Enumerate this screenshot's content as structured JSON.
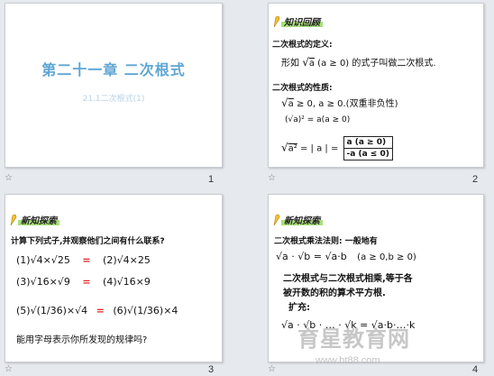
{
  "slides": [
    {
      "title": "第二十一章 二次根式",
      "subtitle": "21.1二次根式(1)",
      "number": "1"
    },
    {
      "badge": "知识回顾",
      "def_heading": "二次根式的定义:",
      "def_text_pre": "形如",
      "def_text_post": "的式子叫做二次根式.",
      "def_expr": "a",
      "def_cond": "(a ≥ 0)",
      "prop_heading": "二次根式的性质:",
      "prop1": "≥ 0, a ≥ 0.(双重非负性)",
      "prop2": "= a(a ≥ 0)",
      "prop3": "= | a | =",
      "case1": "a  (a ≥ 0)",
      "case2": "-a  (a ≤ 0)",
      "number": "2"
    },
    {
      "badge": "新知探索",
      "instruction": "计算下列式子,并观察他们之间有什么联系?",
      "rows": [
        {
          "left": "(1)√4×√25",
          "right": "(2)√4×25"
        },
        {
          "left": "(3)√16×√9",
          "right": "(4)√16×9"
        },
        {
          "left": "(5)√(1/36)×√4",
          "right": "(6)√(1/36)×4"
        }
      ],
      "eq": "=",
      "question": "能用字母表示你所发现的规律吗?",
      "number": "3"
    },
    {
      "badge": "新知探索",
      "rule_heading": "二次根式乘法法则: 一般地有",
      "formula": "√a · √b = √a·b",
      "formula_cond": "(a ≥ 0,b ≥ 0)",
      "explain1": "二次根式与二次根式相乘,等于各",
      "explain2": "被开数的积的算术平方根.",
      "extend": "扩充:",
      "extend_formula": "√a · √b · … · √k = √a·b·…·k",
      "number": "4"
    }
  ],
  "watermark": "育星教育网",
  "watermark_url": "www.ht88.com",
  "colors": {
    "title_blue": "#5ea6d4",
    "highlight_green": "#a8e07a",
    "equals_red": "#e22020"
  },
  "icons": [
    "slide-star-icon",
    "pencil-icon"
  ]
}
